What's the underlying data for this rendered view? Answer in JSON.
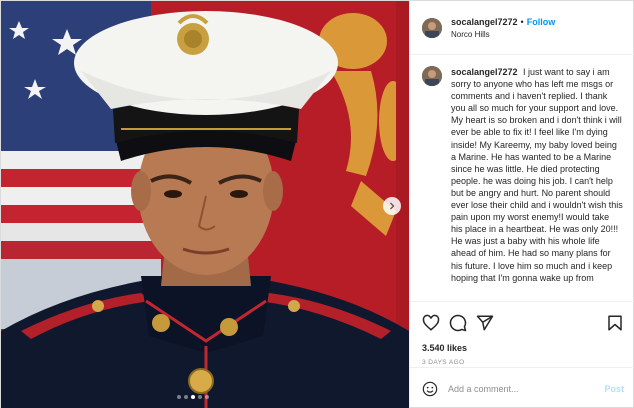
{
  "post": {
    "username": "socalangel7272",
    "separator": "•",
    "follow_label": "Follow",
    "location": "Norco Hills",
    "caption": "I just want to say i am sorry to anyone who has left me msgs or comments and i haven't replied. I thank you all so much for your support and love. My heart is so broken and i don't think i will ever be able to fix it! I feel like I'm dying inside! My Kareemy, my baby loved being a Marine. He has wanted to be a Marine since he was little. He died protecting people. he was doing his job. I can't help but be angry and hurt. No parent should ever lose their child and i wouldn't wish this pain upon my worst enemy!I would take his place in a heartbeat. He was only 20!!! He was just a baby with his whole life ahead of him. He had so many plans for his future. I love him so much and i keep hoping that I'm gonna wake up from",
    "likes": "3.540 likes",
    "date": "3 DAYS AGO"
  },
  "comment": {
    "placeholder": "Add a comment...",
    "post_label": "Post"
  },
  "icons": {
    "like": "heart-icon",
    "comment": "comment-icon",
    "share": "share-icon",
    "save": "bookmark-icon",
    "emoji": "emoji-icon",
    "next": "chevron-right-icon"
  },
  "carousel": {
    "slides": 5,
    "active_index": 2
  },
  "colors": {
    "accent": "#0095f6",
    "post_disabled": "#b2dffc",
    "muted": "#8e8e8e",
    "flag_red": "#c8202a",
    "uniform_navy": "#10182e"
  }
}
